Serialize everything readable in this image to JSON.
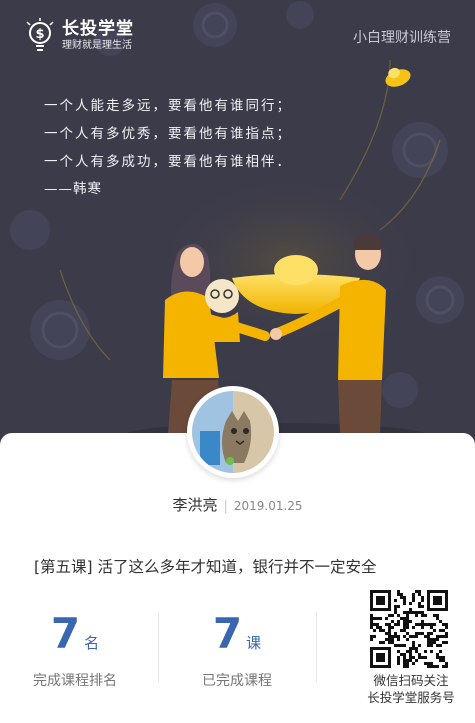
{
  "header": {
    "brand_name": "长投学堂",
    "brand_slogan": "理财就是理生活",
    "program_name": "小白理财训练营",
    "logo_icon": "lightbulb-dollar-icon"
  },
  "quote": {
    "lines": [
      "一个人能走多远，要看他有谁同行；",
      "一个人有多优秀，要看他有谁指点；",
      "一个人有多成功，要看他有谁相伴．"
    ],
    "author": "——韩寒"
  },
  "user": {
    "name": "李洪亮",
    "separator": "|",
    "date": "2019.01.25",
    "avatar_icon": "cat-avatar-icon"
  },
  "lesson": {
    "title": "[第五课] 活了这么多年才知道，银行并不一定安全"
  },
  "stats": {
    "rank": {
      "value": "7",
      "unit": "名",
      "caption": "完成课程排名"
    },
    "completed": {
      "value": "7",
      "unit": "课",
      "caption": "已完成课程"
    }
  },
  "qr": {
    "icon": "qr-code-icon",
    "caption_line1": "微信扫码关注",
    "caption_line2": "长投学堂服务号"
  },
  "colors": {
    "hero_bg": "#3b3b4a",
    "accent_blue": "#3a66b0",
    "gold": "#f5c316"
  }
}
